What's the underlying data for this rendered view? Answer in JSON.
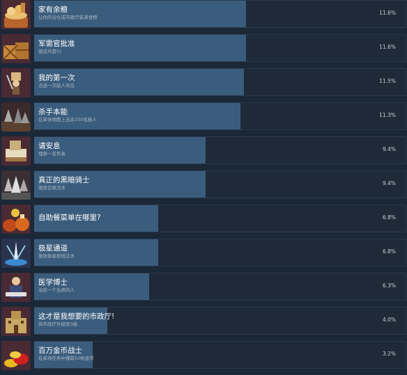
{
  "achievements": [
    {
      "icon": "grain-basket-icon",
      "title": "家有余粮",
      "desc": "让你的谷仓或市政厅装满食物",
      "percent": "11.6%",
      "value": 11.6,
      "bg": "#4a2a33"
    },
    {
      "icon": "supply-crates-icon",
      "title": "军需官批准",
      "desc": "建造兵营(I)",
      "percent": "11.6%",
      "value": 11.6,
      "bg": "#4a2a33"
    },
    {
      "icon": "first-battle-icon",
      "title": "我的第一次",
      "desc": "击退一次敌人攻击",
      "percent": "11.5%",
      "value": 11.5,
      "bg": "#4a2a33"
    },
    {
      "icon": "battlefield-icon",
      "title": "杀手本能",
      "desc": "在单张地图上击杀150名敌人",
      "percent": "11.3%",
      "value": 11.3,
      "bg": "#3a2a2c"
    },
    {
      "icon": "coffin-icon",
      "title": "请安息",
      "desc": "埋葬一名死者",
      "percent": "9.4%",
      "value": 9.4,
      "bg": "#4a2a33"
    },
    {
      "icon": "dark-knights-icon",
      "title": "真正的黑暗骑士",
      "desc": "施放召唤法术",
      "percent": "9.4%",
      "value": 9.4,
      "bg": "#3a3034"
    },
    {
      "icon": "food-pots-icon",
      "title": "自助餐菜单在哪里?",
      "desc": "",
      "percent": "6.8%",
      "value": 6.8,
      "bg": "#4a2a33"
    },
    {
      "icon": "star-beam-icon",
      "title": "极星通道",
      "desc": "施放极星射线法术",
      "percent": "6.8%",
      "value": 6.8,
      "bg": "#2a3450"
    },
    {
      "icon": "doctor-icon",
      "title": "医学博士",
      "desc": "治愈一个生病的人",
      "percent": "6.3%",
      "value": 6.3,
      "bg": "#4a2a33"
    },
    {
      "icon": "town-hall-icon",
      "title": "这才是我想要的市政厅!",
      "desc": "将市政厅升级至3级",
      "percent": "4.0%",
      "value": 4.0,
      "bg": "#4a2a33"
    },
    {
      "icon": "gold-coins-icon",
      "title": "百万金币战士",
      "desc": "在单场任务中赚取50枚金币",
      "percent": "3.2%",
      "value": 3.2,
      "bg": "#4a2a33"
    }
  ]
}
